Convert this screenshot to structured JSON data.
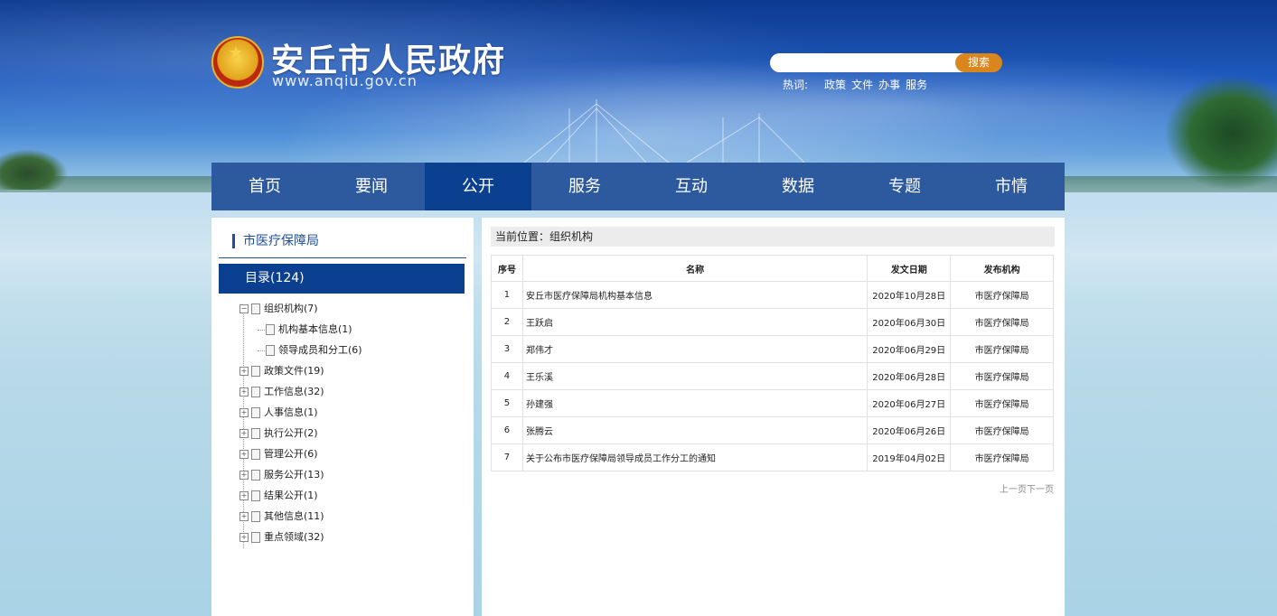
{
  "header": {
    "site_name": "安丘市人民政府",
    "site_url": "www.anqiu.gov.cn",
    "search": {
      "placeholder": "",
      "button_label": "搜索"
    },
    "hotwords": {
      "label": "热词:",
      "items": [
        "政策",
        "文件",
        "办事",
        "服务"
      ]
    }
  },
  "nav": {
    "items": [
      "首页",
      "要闻",
      "公开",
      "服务",
      "互动",
      "数据",
      "专题",
      "市情"
    ],
    "active": "公开"
  },
  "sidebar": {
    "department": "市医疗保障局",
    "directory": "目录(124)",
    "tree": [
      {
        "label": "组织机构(7)",
        "expanded": true,
        "children": [
          "机构基本信息(1)",
          "领导成员和分工(6)"
        ]
      },
      {
        "label": "政策文件(19)"
      },
      {
        "label": "工作信息(32)"
      },
      {
        "label": "人事信息(1)"
      },
      {
        "label": "执行公开(2)"
      },
      {
        "label": "管理公开(6)"
      },
      {
        "label": "服务公开(13)"
      },
      {
        "label": "结果公开(1)"
      },
      {
        "label": "其他信息(11)"
      },
      {
        "label": "重点领域(32)"
      }
    ]
  },
  "main": {
    "breadcrumb": "当前位置：组织机构",
    "table": {
      "headers": [
        "序号",
        "名称",
        "发文日期",
        "发布机构"
      ],
      "rows": [
        [
          "1",
          "安丘市医疗保障局机构基本信息",
          "2020年10月28日",
          "市医疗保障局"
        ],
        [
          "2",
          "王跃启",
          "2020年06月30日",
          "市医疗保障局"
        ],
        [
          "3",
          "郑伟才",
          "2020年06月29日",
          "市医疗保障局"
        ],
        [
          "4",
          "王乐溪",
          "2020年06月28日",
          "市医疗保障局"
        ],
        [
          "5",
          "孙建强",
          "2020年06月27日",
          "市医疗保障局"
        ],
        [
          "6",
          "张腾云",
          "2020年06月26日",
          "市医疗保障局"
        ],
        [
          "7",
          "关于公布市医疗保障局领导成员工作分工的通知",
          "2019年04月02日",
          "市医疗保障局"
        ]
      ]
    },
    "pager": {
      "prev": "上一页",
      "next": "下一页"
    }
  }
}
